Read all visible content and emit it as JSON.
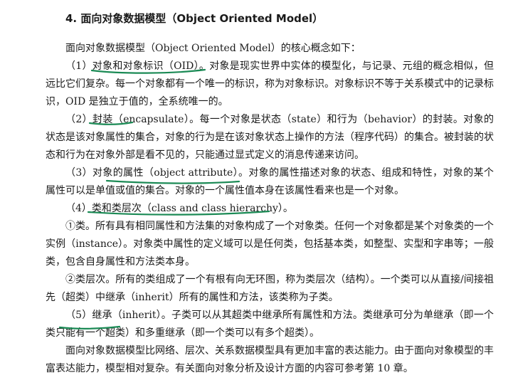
{
  "heading": "4. 面向对象数据模型（Object Oriented Model）",
  "paragraphs": {
    "intro": "面向对象数据模型（Object Oriented Model）的核心概念如下：",
    "oid": "（1）对象和对象标识（OID）。对象是现实世界中实体的模型化，与记录、元组的概念相似，但远比它们复杂。每一个对象都有一个唯一的标识，称为对象标识。对象标识不等于关系模式中的记录标识，OID 是独立于值的，全系统唯一的。",
    "encapsulation": "（2）封装（encapsulate）。每一个对象是状态（state）和行为（behavior）的封装。对象的状态是该对象属性的集合，对象的行为是在该对象状态上操作的方法（程序代码）的集合。被封装的状态和行为在对象外部是看不见的，只能通过显式定义的消息传递来访问。",
    "attribute": "（3）对象的属性（object attribute）。对象的属性描述对象的状态、组成和特性，对象的某个属性可以是单值或值的集合。对象的一个属性值本身在该属性看来也是一个对象。",
    "class_hierarchy": "（4）类和类层次（class and class hierarchy）。",
    "class_def": "①类。所有具有相同属性和方法集的对象构成了一个对象类。任何一个对象都是某个对象类的一个实例（instance）。对象类中属性的定义域可以是任何类，包括基本类，如整型、实型和字串等；一般类，包含自身属性和方法类本身。",
    "hierarchy_def": "②类层次。所有的类组成了一个有根有向无环图，称为类层次（结构）。一个类可以从直接/间接祖先（超类）中继承（inherit）所有的属性和方法，该类称为子类。",
    "inherit": "（5）继承（inherit）。子类可以从其超类中继承所有属性和方法。类继承可分为单继承（即一个类只能有一个超类）和多重继承（即一个类可以有多个超类）。",
    "summary": "面向对象数据模型比网络、层次、关系数据模型具有更加丰富的表达能力。由于面向对象模型的丰富表达能力，模型相对复杂。有关面向对象分析及设计方面的内容可参考第 10 章。"
  },
  "colors": {
    "text": "#1a1a1a",
    "annotation": "#1b8a55"
  }
}
